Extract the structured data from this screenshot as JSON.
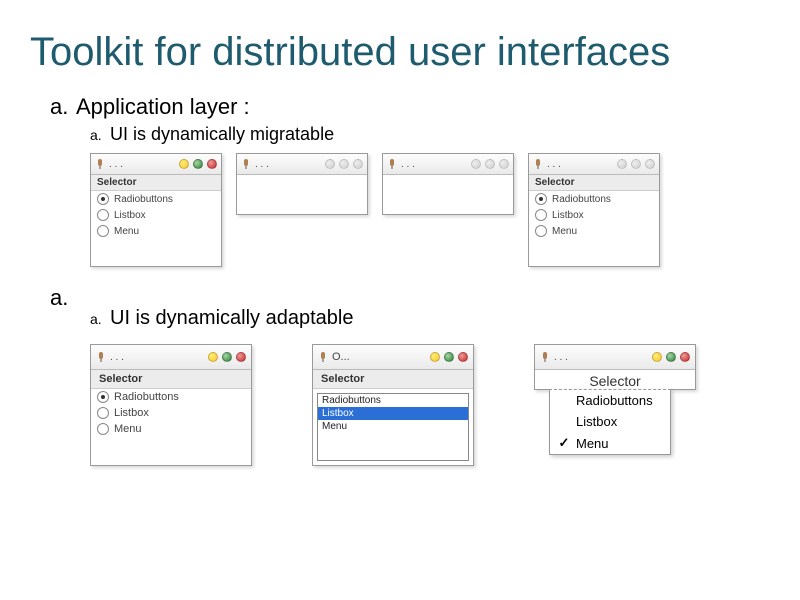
{
  "title": "Toolkit for distributed user interfaces",
  "list": {
    "a_marker": "a.",
    "application_layer": "Application layer :",
    "sub_marker": "a.",
    "migratable": "UI is dynamically migratable",
    "adaptable": "UI is dynamically adaptable"
  },
  "selector": {
    "header": "Selector",
    "items": [
      "Radiobuttons",
      "Listbox",
      "Menu"
    ]
  },
  "titlebar": {
    "dots_text": ". . ."
  },
  "listbox": {
    "selected": "Listbox"
  },
  "menu": {
    "checked": "Menu"
  }
}
